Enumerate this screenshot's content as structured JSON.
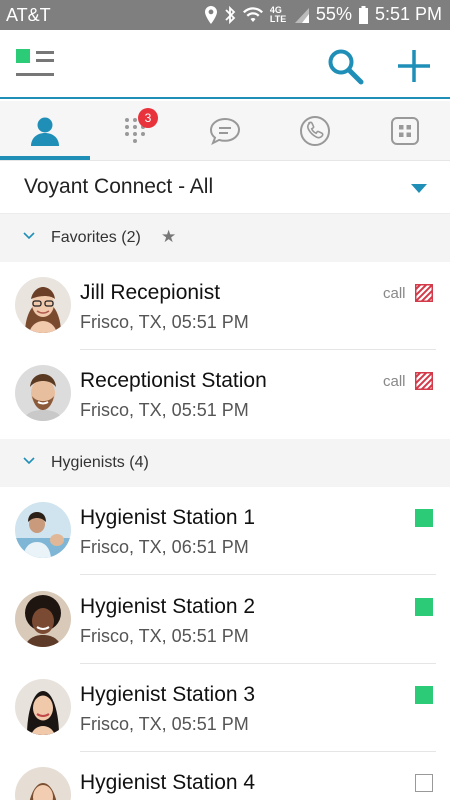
{
  "status_bar": {
    "carrier": "AT&T",
    "network": "4G LTE",
    "battery": "55%",
    "time": "5:51 PM"
  },
  "colors": {
    "accent": "#1f8fb8",
    "badge": "#e8323c",
    "status_available": "#2ccb78",
    "status_busy": "#d43b4a"
  },
  "appbar": {
    "menu_icon": "menu-icon",
    "search_icon": "search-icon",
    "add_icon": "plus-icon"
  },
  "tabs": [
    {
      "icon": "contacts-person-icon",
      "active": true
    },
    {
      "icon": "dialpad-icon",
      "badge": "3"
    },
    {
      "icon": "chat-bubble-icon"
    },
    {
      "icon": "phone-history-icon"
    },
    {
      "icon": "apps-grid-icon"
    }
  ],
  "filter": {
    "label": "Voyant Connect -  All"
  },
  "groups": {
    "favorites": {
      "label": "Favorites (2)"
    },
    "hygienists": {
      "label": "Hygienists (4)"
    }
  },
  "contacts": [
    {
      "name": "Jill Recepionist",
      "sub": "Frisco, TX, 05:51 PM",
      "call": "call",
      "status": "busy"
    },
    {
      "name": "Receptionist Station",
      "sub": "Frisco, TX, 05:51 PM",
      "call": "call",
      "status": "busy"
    },
    {
      "name": "Hygienist Station 1",
      "sub": "Frisco, TX, 06:51 PM",
      "call": "",
      "status": "available"
    },
    {
      "name": "Hygienist Station 2",
      "sub": "Frisco, TX, 05:51 PM",
      "call": "",
      "status": "available"
    },
    {
      "name": "Hygienist Station 3",
      "sub": "Frisco, TX, 05:51 PM",
      "call": "",
      "status": "available"
    },
    {
      "name": "Hygienist Station 4",
      "sub": "",
      "call": "",
      "status": "offline"
    }
  ]
}
